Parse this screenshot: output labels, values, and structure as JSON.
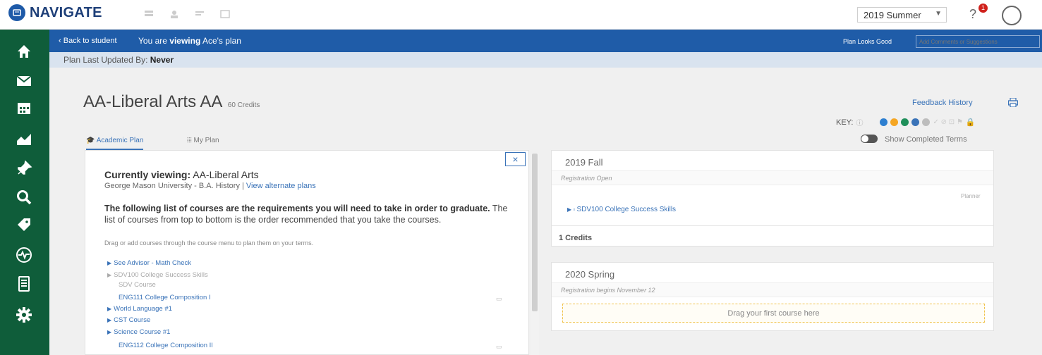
{
  "header": {
    "app_name": "NAVIGATE",
    "term_select": "2019 Summer",
    "notification_count": "1",
    "help": "?"
  },
  "sidebar": {
    "items": [
      {
        "icon": "home-icon"
      },
      {
        "icon": "mail-icon"
      },
      {
        "icon": "calendar-icon"
      },
      {
        "icon": "chart-icon"
      },
      {
        "icon": "pin-icon"
      },
      {
        "icon": "search-icon"
      },
      {
        "icon": "tag-icon"
      },
      {
        "icon": "health-icon"
      },
      {
        "icon": "document-icon"
      },
      {
        "icon": "gear-icon"
      }
    ]
  },
  "bluebar": {
    "back_label": "Back to student",
    "viewing_prefix": "You are ",
    "viewing_bold": "viewing",
    "viewing_suffix": " Ace's plan",
    "plan_good_label": "Plan Looks Good",
    "comments_placeholder": "Add Comments or Suggestions"
  },
  "last_updated": {
    "label": "Plan Last Updated By: ",
    "value": "Never"
  },
  "plan": {
    "title": "AA-Liberal Arts AA",
    "credits": "60 Credits",
    "feedback_label": "Feedback History",
    "key_label": "KEY:",
    "show_completed_label": "Show Completed Terms",
    "tabs": [
      {
        "label": "Academic Plan"
      },
      {
        "label": "My Plan"
      }
    ]
  },
  "academic": {
    "close": "×",
    "currently_label": "Currently viewing:",
    "currently_value": " AA-Liberal Arts",
    "school": "George Mason University - B.A. History | ",
    "alt_link": "View alternate plans",
    "req_bold": "The following list of courses are the requirements you will need to take in order to graduate.",
    "req_text": " The list of courses from top to bottom is the order recommended that you take the courses.",
    "drag_note": "Drag or add courses through the course menu to plan them on your terms.",
    "courses": [
      {
        "label": "See Advisor - Math Check"
      },
      {
        "label": "SDV100 College Success Skills"
      },
      {
        "label": "SDV Course"
      },
      {
        "label": "ENG111 College Composition I"
      },
      {
        "label": "World Language #1"
      },
      {
        "label": "CST Course"
      },
      {
        "label": "Science Course #1"
      },
      {
        "label": "ENG112 College Composition II"
      }
    ]
  },
  "terms": [
    {
      "name": "2019 Fall",
      "status": "Registration Open",
      "planner": "Planner",
      "course": "SDV100 College Success Skills",
      "credits": "1 Credits"
    },
    {
      "name": "2020 Spring",
      "status": "Registration begins November 12",
      "drop_label": "Drag your first course here"
    }
  ],
  "colors": {
    "sidebar": "#0f5d3a",
    "bluebar": "#1f5ca8",
    "link": "#3a73b8",
    "key_dots": [
      "#2d7fd0",
      "#f5a623",
      "#1f8f5a",
      "#3a73b8",
      "#bdbdbd"
    ]
  }
}
